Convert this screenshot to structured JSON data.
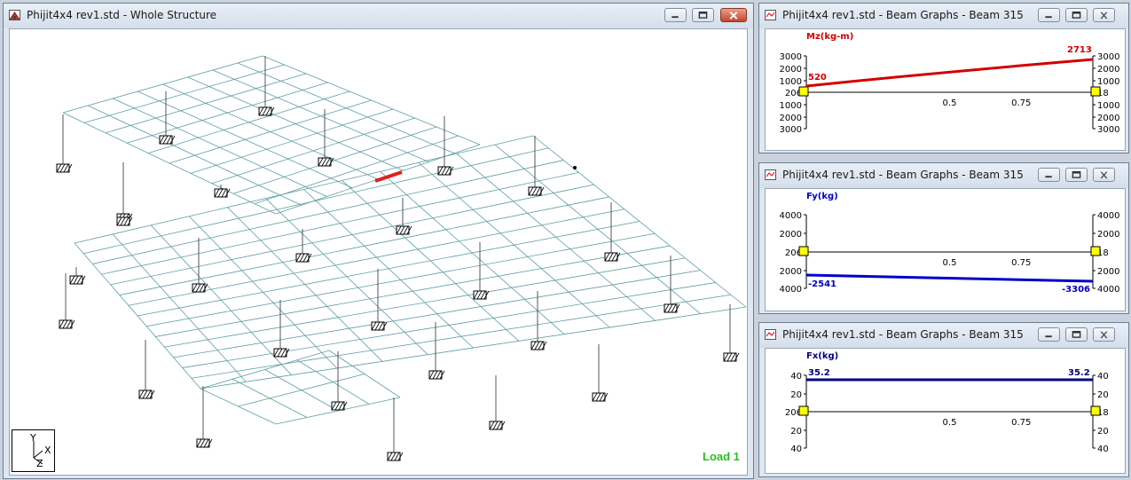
{
  "main_window": {
    "title": "Phijit4x4 rev1.std - Whole Structure",
    "load_label": "Load 1",
    "axis_labels": {
      "y": "Y",
      "z": "Z",
      "x": "X"
    }
  },
  "graph_windows": [
    {
      "title": "Phijit4x4 rev1.std - Beam Graphs - Beam 315",
      "quantity": "Mz(kg-m)",
      "color": "#d10000",
      "left_ticks": [
        "3000",
        "2000",
        "1000",
        "206",
        "1000",
        "2000",
        "3000"
      ],
      "right_ticks": [
        "3000",
        "2000",
        "1000",
        "18",
        "1000",
        "2000",
        "3000"
      ],
      "x_ticks": [
        "0.5",
        "0.75"
      ],
      "start_value": "520",
      "end_value": "2713"
    },
    {
      "title": "Phijit4x4 rev1.std - Beam Graphs - Beam 315",
      "quantity": "Fy(kg)",
      "color": "#0000c8",
      "left_ticks": [
        "4000",
        "2000",
        "206",
        "2000",
        "4000"
      ],
      "right_ticks": [
        "4000",
        "2000",
        "18",
        "2000",
        "4000"
      ],
      "x_ticks": [
        "0.5",
        "0.75"
      ],
      "start_value": "-2541",
      "end_value": "-3306"
    },
    {
      "title": "Phijit4x4 rev1.std - Beam Graphs - Beam 315",
      "quantity": "Fx(kg)",
      "color": "#000080",
      "left_ticks": [
        "40",
        "20",
        "206",
        "20",
        "40"
      ],
      "right_ticks": [
        "40",
        "20",
        "18",
        "20",
        "40"
      ],
      "x_ticks": [
        "0.5",
        "0.75"
      ],
      "start_value": "35.2",
      "end_value": "35.2"
    }
  ]
}
